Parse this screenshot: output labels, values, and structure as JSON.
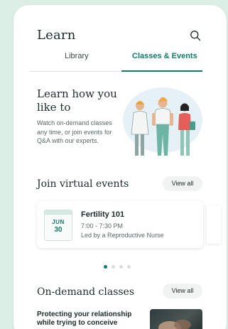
{
  "header": {
    "title": "Learn",
    "search_icon": "search-icon"
  },
  "tabs": [
    {
      "label": "Library",
      "active": false
    },
    {
      "label": "Classes & Events",
      "active": true
    }
  ],
  "hero": {
    "title": "Learn how you like to",
    "description": "Watch on-demand classes any time, or join events for Q&A with our experts."
  },
  "virtual_events": {
    "title": "Join virtual events",
    "view_all_label": "View all",
    "events": [
      {
        "month": "JUN",
        "day": "30",
        "title": "Fertility 101",
        "time": "7:00 - 7:30 PM",
        "host": "Led by a Reproductive Nurse"
      }
    ],
    "carousel": {
      "count": 4,
      "active_index": 0
    }
  },
  "on_demand": {
    "title": "On-demand classes",
    "view_all_label": "View all",
    "classes": [
      {
        "title": "Protecting your relationship while trying to conceive"
      }
    ]
  },
  "colors": {
    "accent": "#137a68",
    "background": "#dcefe6",
    "text": "#1c2a2a"
  }
}
